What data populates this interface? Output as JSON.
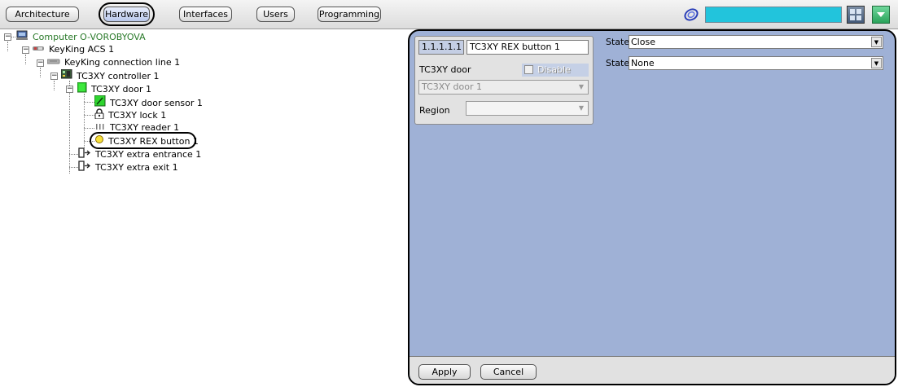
{
  "toolbar": {
    "tabs": [
      {
        "label": "Architecture",
        "active": false
      },
      {
        "label": "Hardware",
        "active": true
      },
      {
        "label": "Interfaces",
        "active": false
      },
      {
        "label": "Users",
        "active": false
      },
      {
        "label": "Programming",
        "active": false
      }
    ],
    "search_color": "#22c4dc"
  },
  "tree": {
    "nodes": [
      {
        "label": "Computer O-VOROBYOVA",
        "icon": "computer-icon"
      },
      {
        "label": "KeyKing ACS 1",
        "icon": "acs-icon"
      },
      {
        "label": "KeyKing connection line 1",
        "icon": "connection-line-icon"
      },
      {
        "label": "TC3XY controller 1",
        "icon": "controller-icon"
      },
      {
        "label": "TC3XY door 1",
        "icon": "door-icon"
      },
      {
        "label": "TC3XY door sensor 1",
        "icon": "door-sensor-icon"
      },
      {
        "label": "TC3XY lock 1",
        "icon": "lock-icon"
      },
      {
        "label": "TC3XY reader 1",
        "icon": "reader-icon"
      },
      {
        "label": "TC3XY REX button 1",
        "icon": "rex-button-icon",
        "selected": true
      },
      {
        "label": "TC3XY extra entrance 1",
        "icon": "extra-entrance-icon"
      },
      {
        "label": "TC3XY extra exit 1",
        "icon": "extra-exit-icon"
      }
    ]
  },
  "settings": {
    "id": "1.1.1.1.1",
    "name": "TC3XY REX button 1",
    "door_label": "TC3XY door",
    "disable_label": "Disable",
    "door_value": "TC3XY door 1",
    "region_label": "Region",
    "region_value": "",
    "states": [
      {
        "label": "State",
        "value": "Close"
      },
      {
        "label": "State",
        "value": "None"
      }
    ],
    "apply_label": "Apply",
    "cancel_label": "Cancel",
    "panel_color": "#9fb1d6"
  }
}
